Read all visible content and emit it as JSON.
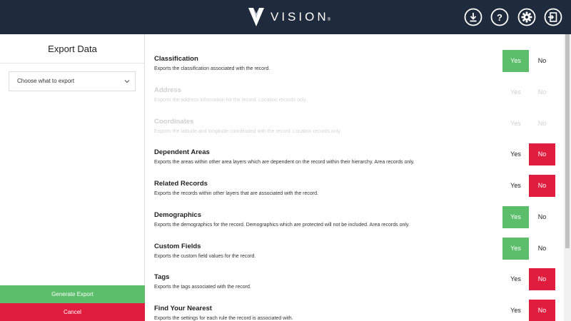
{
  "app": {
    "brand": "VISION",
    "brand_mark": "®",
    "colors": {
      "topbar": "#1f2b3c",
      "yes_active": "#5cbd6b",
      "no_active": "#e11d3f"
    }
  },
  "header_icons": [
    {
      "name": "download-icon"
    },
    {
      "name": "help-icon"
    },
    {
      "name": "settings-gear-icon"
    },
    {
      "name": "logout-icon"
    }
  ],
  "sidebar": {
    "title": "Export Data",
    "select_value": "Choose what to export",
    "generate_label": "Generate Export",
    "cancel_label": "Cancel"
  },
  "yes_label": "Yes",
  "no_label": "No",
  "options": [
    {
      "title": "Classification",
      "description": "Exports the classification associated with the record.",
      "enabled": true,
      "value": "yes"
    },
    {
      "title": "Address",
      "description": "Exports the address information for the record. Location records only.",
      "enabled": false,
      "value": "none"
    },
    {
      "title": "Coordinates",
      "description": "Exports the latitude and longitude coordinated with the record. Location records only.",
      "enabled": false,
      "value": "none"
    },
    {
      "title": "Dependent Areas",
      "description": "Exports the areas within other area layers which are dependent on the record within their hierarchy. Area records only.",
      "enabled": true,
      "value": "no"
    },
    {
      "title": "Related Records",
      "description": "Exports the records within other layers that are associated with the record.",
      "enabled": true,
      "value": "no"
    },
    {
      "title": "Demographics",
      "description": "Exports the demographics for the record. Demographics which are protected will not be included. Area records only.",
      "enabled": true,
      "value": "yes"
    },
    {
      "title": "Custom Fields",
      "description": "Exports the custom field values for the record.",
      "enabled": true,
      "value": "yes"
    },
    {
      "title": "Tags",
      "description": "Exports the tags associated with the record.",
      "enabled": true,
      "value": "no"
    },
    {
      "title": "Find Your Nearest",
      "description": "Exports the settings for each rule the record is associated with.",
      "enabled": true,
      "value": "no"
    }
  ]
}
